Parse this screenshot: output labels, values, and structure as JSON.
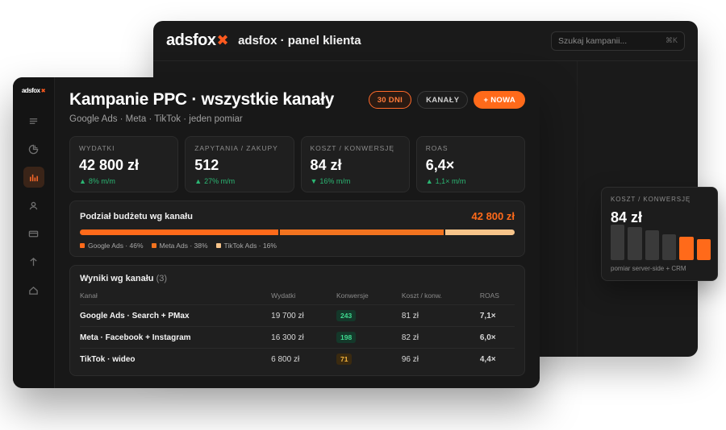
{
  "brand": {
    "word": "adsfox",
    "accent": "#ff5a1f"
  },
  "back_window": {
    "title": "adsfox · panel klienta",
    "search_placeholder": "Szukaj kampanii...",
    "search_shortcut": "⌘K"
  },
  "sidebar": {
    "items": [
      {
        "icon": "menu-icon",
        "active": false
      },
      {
        "icon": "pie-chart-icon",
        "active": false
      },
      {
        "icon": "bar-chart-icon",
        "active": true
      },
      {
        "icon": "user-icon",
        "active": false
      },
      {
        "icon": "card-icon",
        "active": false
      },
      {
        "icon": "arrow-up-icon",
        "active": false
      },
      {
        "icon": "home-icon",
        "active": false
      }
    ]
  },
  "header": {
    "title": "Kampanie PPC · wszystkie kanały",
    "subtitle": "Google Ads · Meta · TikTok · jeden pomiar",
    "period_label": "30 DNI",
    "channels_label": "KANAŁY",
    "new_label": "+ NOWA"
  },
  "kpis": [
    {
      "label": "WYDATKI",
      "value": "42 800 zł",
      "delta": "8% m/m",
      "direction": "up"
    },
    {
      "label": "ZAPYTANIA / ZAKUPY",
      "value": "512",
      "delta": "27% m/m",
      "direction": "up"
    },
    {
      "label": "KOSZT / KONWERSJĘ",
      "value": "84 zł",
      "delta": "16% m/m",
      "direction": "down"
    },
    {
      "label": "ROAS",
      "value": "6,4×",
      "delta": "1,1× m/m",
      "direction": "up"
    }
  ],
  "budget": {
    "title": "Podział budżetu wg kanału",
    "total": "42 800 zł",
    "segments": [
      {
        "label": "Google Ads · 46%",
        "share": 46,
        "color": "#ff6a1a"
      },
      {
        "label": "Meta Ads · 38%",
        "share": 38,
        "color": "#f2731f"
      },
      {
        "label": "TikTok Ads · 16%",
        "share": 16,
        "color": "#f7c48a"
      }
    ]
  },
  "results": {
    "title": "Wyniki wg kanału",
    "count": "(3)",
    "columns": [
      "Kanał",
      "Wydatki",
      "Konwersje",
      "Koszt / konw.",
      "ROAS"
    ],
    "rows": [
      {
        "channel": "Google Ads · Search + PMax",
        "spend": "19 700 zł",
        "conversions": "243",
        "conv_tone": "green",
        "cost": "81 zł",
        "roas": "7,1×"
      },
      {
        "channel": "Meta · Facebook + Instagram",
        "spend": "16 300 zł",
        "conversions": "198",
        "conv_tone": "green",
        "cost": "82 zł",
        "roas": "6,0×"
      },
      {
        "channel": "TikTok · wideo",
        "spend": "6 800 zł",
        "conversions": "71",
        "conv_tone": "amber",
        "cost": "96 zł",
        "roas": "4,4×"
      }
    ]
  },
  "float_card": {
    "label": "KOSZT / KONWERSJĘ",
    "value": "84 zł",
    "note": "pomiar server-side + CRM",
    "bars": [
      {
        "level": 0.95,
        "color": "#3a3a3a"
      },
      {
        "level": 0.9,
        "color": "#3a3a3a"
      },
      {
        "level": 0.8,
        "color": "#3a3a3a"
      },
      {
        "level": 0.7,
        "color": "#3a3a3a"
      },
      {
        "level": 0.62,
        "color": "#ff6a1a"
      },
      {
        "level": 0.57,
        "color": "#ff6a1a"
      }
    ]
  }
}
